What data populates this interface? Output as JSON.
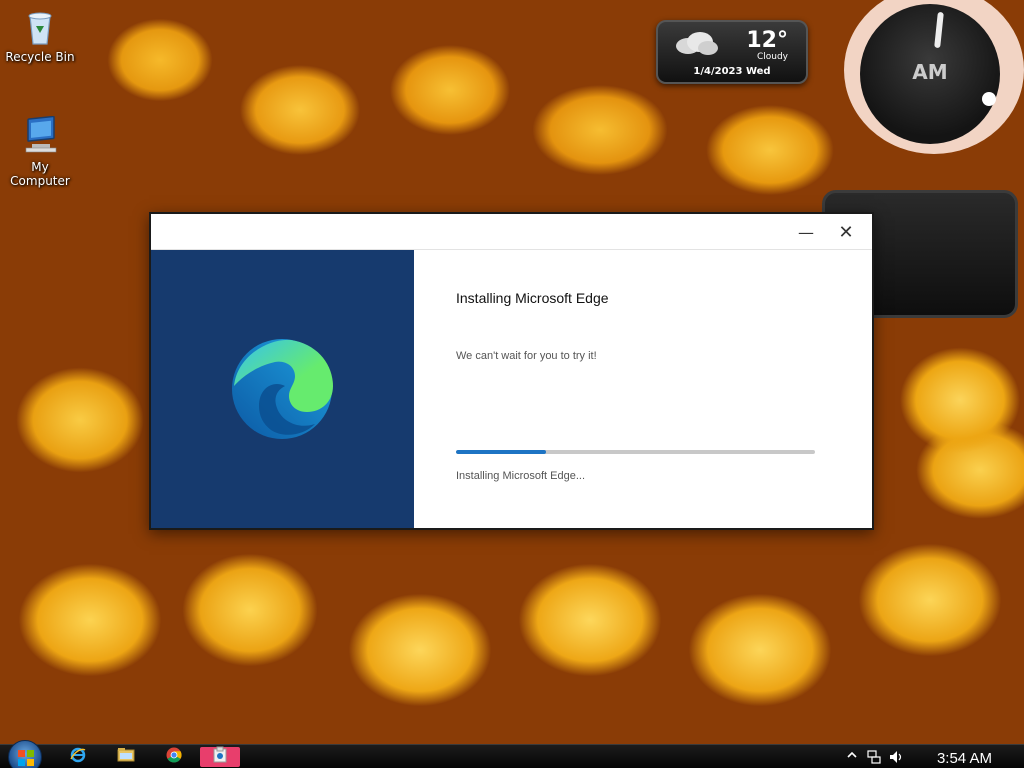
{
  "desktop": {
    "icons": [
      {
        "label": "Recycle Bin",
        "icon": "recycle-bin-icon"
      },
      {
        "label": "My Computer",
        "icon": "my-computer-icon"
      }
    ]
  },
  "weather_gadget": {
    "temperature": "12°",
    "condition": "Cloudy",
    "date": "1/4/2023 Wed",
    "icon": "cloud-icon"
  },
  "clock_gadget": {
    "period": "AM"
  },
  "installer": {
    "title": "Installing Microsoft Edge",
    "subtitle": "We can't wait for you to try it!",
    "status": "Installing Microsoft Edge...",
    "progress_percent": 25,
    "minimize_symbol": "—",
    "close_symbol": "✕",
    "colors": {
      "left_panel": "#163a6e",
      "progress_fill": "#1d74c4"
    }
  },
  "taskbar": {
    "items": [
      {
        "icon": "start-orb-icon"
      },
      {
        "icon": "internet-explorer-icon"
      },
      {
        "icon": "file-explorer-icon"
      },
      {
        "icon": "chrome-icon"
      },
      {
        "icon": "installer-app-icon",
        "active": true
      }
    ],
    "tray": {
      "time": "3:54 AM"
    }
  }
}
